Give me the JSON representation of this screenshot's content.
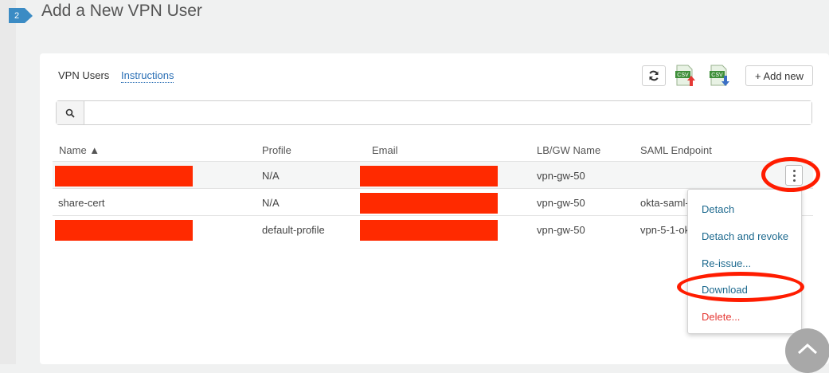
{
  "header": {
    "step_number": "2",
    "title": "Add a New VPN User"
  },
  "tabs": {
    "users_label": "VPN Users",
    "instructions_label": "Instructions"
  },
  "toolbar": {
    "refresh_icon": "refresh-icon",
    "upload_csv_icon": "csv-upload-icon",
    "download_csv_icon": "csv-download-icon",
    "add_new_label": "+ Add new"
  },
  "search": {
    "placeholder": "",
    "value": ""
  },
  "table": {
    "columns": [
      "Name ▲",
      "Profile",
      "Email",
      "LB/GW Name",
      "SAML Endpoint"
    ],
    "rows": [
      {
        "name": "",
        "profile": "N/A",
        "email": "",
        "gw": "vpn-gw-50",
        "saml": ""
      },
      {
        "name": "share-cert",
        "profile": "N/A",
        "email": "",
        "gw": "vpn-gw-50",
        "saml": "okta-saml-"
      },
      {
        "name": "",
        "profile": "default-profile",
        "email": "",
        "gw": "vpn-gw-50",
        "saml": "vpn-5-1-ok"
      }
    ]
  },
  "row_menu": {
    "items": [
      "Detach",
      "Detach and revoke",
      "Re-issue...",
      "Download",
      "Delete..."
    ]
  },
  "colors": {
    "accent": "#3b8bc4",
    "link": "#2a6fb5",
    "annotation": "#ff1c00",
    "danger": "#e53935"
  }
}
